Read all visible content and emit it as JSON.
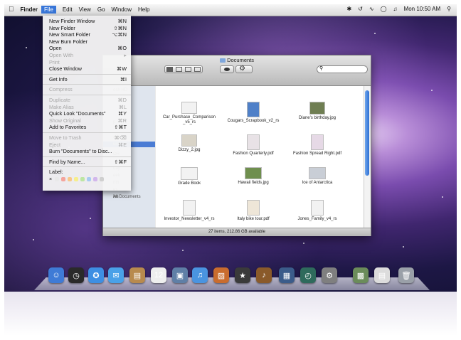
{
  "menubar": {
    "apple": "",
    "app": "Finder",
    "menus": [
      "File",
      "Edit",
      "View",
      "Go",
      "Window",
      "Help"
    ],
    "clock": "Mon 10:50 AM"
  },
  "file_menu": {
    "items": [
      {
        "label": "New Finder Window",
        "shortcut": "⌘N",
        "enabled": true
      },
      {
        "label": "New Folder",
        "shortcut": "⇧⌘N",
        "enabled": true
      },
      {
        "label": "New Smart Folder",
        "shortcut": "⌥⌘N",
        "enabled": true
      },
      {
        "label": "New Burn Folder",
        "shortcut": "",
        "enabled": true
      },
      {
        "label": "Open",
        "shortcut": "⌘O",
        "enabled": true
      },
      {
        "label": "Open With",
        "shortcut": "▸",
        "enabled": false
      },
      {
        "label": "Print",
        "shortcut": "",
        "enabled": false
      },
      {
        "label": "Close Window",
        "shortcut": "⌘W",
        "enabled": true
      },
      {
        "label": "Get Info",
        "shortcut": "⌘I",
        "enabled": true
      },
      {
        "label": "Compress",
        "shortcut": "",
        "enabled": false
      },
      {
        "label": "Duplicate",
        "shortcut": "⌘D",
        "enabled": false
      },
      {
        "label": "Make Alias",
        "shortcut": "⌘L",
        "enabled": false
      },
      {
        "label": "Quick Look \"Documents\"",
        "shortcut": "⌘Y",
        "enabled": true
      },
      {
        "label": "Show Original",
        "shortcut": "⌘R",
        "enabled": false
      },
      {
        "label": "Add to Favorites",
        "shortcut": "⇧⌘T",
        "enabled": true
      },
      {
        "label": "Move to Trash",
        "shortcut": "⌘⌫",
        "enabled": false
      },
      {
        "label": "Eject",
        "shortcut": "⌘E",
        "enabled": false
      },
      {
        "label": "Burn \"Documents\" to Disc...",
        "shortcut": "",
        "enabled": true
      },
      {
        "label": "Find by Name...",
        "shortcut": "⇧⌘F",
        "enabled": true
      }
    ],
    "label_heading": "Label:",
    "label_colors": [
      "#e9e9e9",
      "#f4a49c",
      "#f8c88a",
      "#f6ee8c",
      "#bde6a3",
      "#a8cbf2",
      "#d2b6ec",
      "#cfcfcf"
    ]
  },
  "finder": {
    "title": "Documents",
    "sidebar": [
      "osh HD",
      "p",
      "ations",
      "uments",
      "OR",
      "day",
      "eek",
      "nth",
      "es",
      "ies",
      "All Documents"
    ],
    "files": [
      {
        "name": "Car_Purchase_Comparison _v5_rs",
        "icon": "document-icon"
      },
      {
        "name": "Cougars_Scrapbook_v2_rs",
        "icon": "photo-icon"
      },
      {
        "name": "Diane's birthday.jpg",
        "icon": "photo-icon"
      },
      {
        "name": "Dizzy_2.jpg",
        "icon": "photo-icon"
      },
      {
        "name": "Fashion Quarterly.pdf",
        "icon": "pdf-icon"
      },
      {
        "name": "Fashion Spread Right.pdf",
        "icon": "pdf-icon"
      },
      {
        "name": "Grade Book",
        "icon": "spreadsheet-icon"
      },
      {
        "name": "Hawaii fields.jpg",
        "icon": "photo-icon"
      },
      {
        "name": "Ice of Antarctica",
        "icon": "photo-icon"
      },
      {
        "name": "Investor_Newsletter_v4_rs",
        "icon": "document-icon"
      },
      {
        "name": "Italy bike tour.pdf",
        "icon": "pdf-icon"
      },
      {
        "name": "Jones_Family_v4_rs",
        "icon": "document-icon"
      },
      {
        "name": "",
        "icon": "document-icon"
      },
      {
        "name": "",
        "icon": "document-icon"
      },
      {
        "name": "",
        "icon": "photo-icon"
      }
    ],
    "status": "27 items, 212.86 GB available"
  },
  "dock": {
    "apps": [
      {
        "icon": "finder-icon",
        "color": "#3f7bd6"
      },
      {
        "icon": "dashboard-icon",
        "color": "#2a2a2a"
      },
      {
        "icon": "safari-icon",
        "color": "#3e8fe3"
      },
      {
        "icon": "ichat-icon",
        "color": "#4aa1e8"
      },
      {
        "icon": "address-book-icon",
        "color": "#b88a4e"
      },
      {
        "icon": "ical-icon",
        "color": "#eeeeee"
      },
      {
        "icon": "preview-icon",
        "color": "#5f7fa6"
      },
      {
        "icon": "itunes-icon",
        "color": "#4a94e0"
      },
      {
        "icon": "iphoto-icon",
        "color": "#c96c2e"
      },
      {
        "icon": "imovie-icon",
        "color": "#3a3a3a"
      },
      {
        "icon": "garageband-icon",
        "color": "#8a5a2a"
      },
      {
        "icon": "spaces-icon",
        "color": "#3b5c8a"
      },
      {
        "icon": "time-machine-icon",
        "color": "#2e6a5c"
      },
      {
        "icon": "system-preferences-icon",
        "color": "#7f7f7f"
      },
      {
        "icon": "photo-stack-icon",
        "color": "#6b8c5a"
      },
      {
        "icon": "documents-stack-icon",
        "color": "#dcdcdc"
      },
      {
        "icon": "trash-icon",
        "color": "#9aa0a8"
      }
    ]
  }
}
